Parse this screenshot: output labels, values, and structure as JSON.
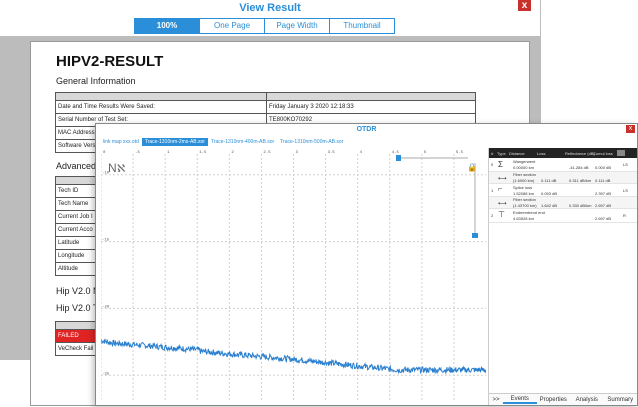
{
  "view_result": {
    "title": "View Result",
    "close": "x",
    "zoom_tabs": [
      "100%",
      "One Page",
      "Page Width",
      "Thumbnail"
    ],
    "active_zoom": "100%"
  },
  "document": {
    "title": "HIPV2-RESULT",
    "general_info": "General Information",
    "table1": [
      [
        "Date and Time Results Were Saved:",
        "Friday January 3 2020 12:18:33"
      ],
      [
        "Serial Number of Test Set:",
        "TE800KO70292"
      ],
      [
        "MAC Address",
        ""
      ],
      [
        "Software Vers",
        ""
      ]
    ],
    "advanced": "Advanced",
    "table2_rows": [
      "Tech ID",
      "Tech Name",
      "Current Job I",
      "Current Acco",
      "Latitude",
      "Longitude",
      "Altitude"
    ],
    "hip_lines": [
      "Hip V2.0 M",
      "Hip V2.0 T"
    ],
    "failed": "FAILED",
    "vecheck": "VeCheck Fail"
  },
  "otdr": {
    "title": "OTDR",
    "close": "x",
    "trace_tabs": [
      "link map xxx.otd",
      "Trace-1310nm-2ms-AB.sor",
      "Trace-1310nm-400m-AB.sor",
      "Trace-1310nm-500m-AB.sor"
    ],
    "active_trace": 1,
    "x_ticks": [
      "0",
      ".5",
      "1",
      "1.5",
      "2",
      "2.5",
      "3",
      "3.5",
      "4",
      "4.5",
      "5",
      "5.5"
    ],
    "y_ticks": [
      "-10",
      "-15",
      "-20",
      "-25"
    ],
    "events": {
      "headers": [
        "#",
        "Type",
        "Distance",
        "Loss",
        "Reflectance (dB)",
        "Cumul loss"
      ],
      "rows": [
        {
          "num": "0",
          "label": "Wangerwent",
          "dist": "0.00000 km",
          "loss": "",
          "refl": "-41.284 dB",
          "cumul": "0.000 dB",
          "flag": "LS"
        },
        {
          "num": "",
          "label": "Fiber section",
          "dist": "(1.6000 km)",
          "loss": "0.111 dB",
          "refl": "0.311 dB/km",
          "cumul": "0.111 dB",
          "flag": ""
        },
        {
          "num": "1",
          "label": "Splice loss",
          "dist": "1.52088 km",
          "loss": "0.093 dB",
          "refl": "",
          "cumul": "2.397 dB",
          "flag": "LS"
        },
        {
          "num": "",
          "label": "Fiber section",
          "dist": "(1.43700 km)",
          "loss": "1.642 dB",
          "refl": "0.330 dB/km",
          "cumul": "2.697 dB",
          "flag": ""
        },
        {
          "num": "2",
          "label": "Endeemtrend end",
          "dist": "4.63528 km",
          "loss": "",
          "refl": "",
          "cumul": "2.697 dB",
          "flag": "R"
        }
      ]
    },
    "bottom_tabs": [
      ">>",
      "Events",
      "Properties",
      "Analysis",
      "Summary"
    ],
    "active_bottom": "Events"
  },
  "chart_data": {
    "type": "line",
    "x_range": [
      0,
      6
    ],
    "y_range": [
      -27,
      -8
    ],
    "trace_color": "#2a7fcf",
    "series": [
      {
        "x": [
          0.0,
          0.2,
          0.5,
          1.0,
          1.52,
          1.55,
          2.0,
          3.0,
          4.0,
          4.63
        ],
        "y": [
          -22.4,
          -22.6,
          -22.7,
          -22.9,
          -23.1,
          -23.2,
          -23.4,
          -23.8,
          -24.3,
          -24.6
        ]
      }
    ]
  }
}
